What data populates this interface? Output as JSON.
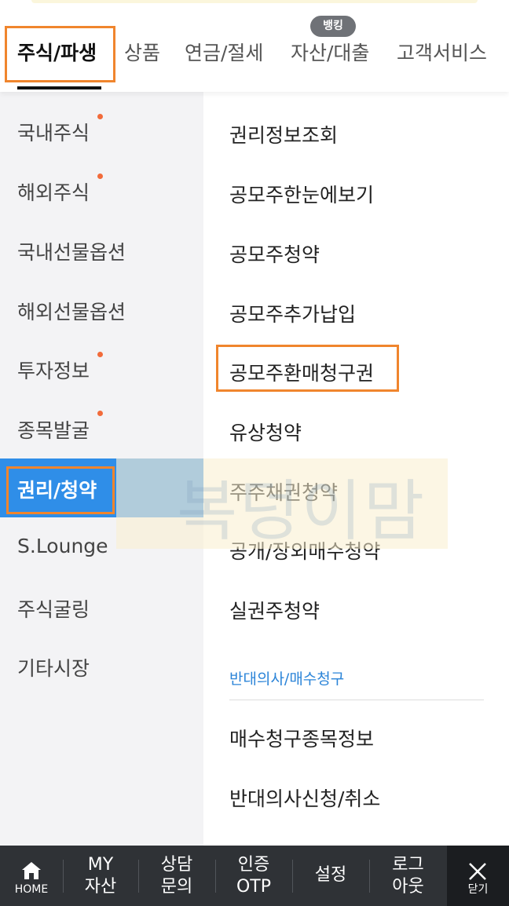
{
  "header": {
    "tabs": [
      {
        "label": "주식/파생",
        "active": true
      },
      {
        "label": "상품"
      },
      {
        "label": "연금/절세"
      },
      {
        "label": "자산/대출",
        "badge": "뱅킹"
      },
      {
        "label": "고객서비스"
      }
    ]
  },
  "left_menu": {
    "items": [
      {
        "label": "국내주식",
        "new": true
      },
      {
        "label": "해외주식",
        "new": true
      },
      {
        "label": "국내선물옵션"
      },
      {
        "label": "해외선물옵션"
      },
      {
        "label": "투자정보",
        "new": true
      },
      {
        "label": "종목발굴",
        "new": true
      },
      {
        "label": "권리/청약",
        "active": true
      },
      {
        "label": "S.Lounge"
      },
      {
        "label": "주식굴링"
      },
      {
        "label": "기타시장"
      }
    ]
  },
  "right_menu": {
    "items": [
      "권리정보조회",
      "공모주한눈에보기",
      "공모주청약",
      "공모주추가납입",
      "공모주환매청구권",
      "유상청약",
      "주주채권청약",
      "공개/장외매수청약",
      "실권주청약"
    ],
    "section": {
      "label": "반대의사/매수청구",
      "items": [
        "매수청구종목정보",
        "반대의사신청/취소"
      ]
    }
  },
  "watermark": "복덩이맘",
  "bottom_bar": {
    "home": "HOME",
    "my": [
      "MY",
      "자산"
    ],
    "consult": [
      "상담",
      "문의"
    ],
    "cert": [
      "인증",
      "OTP"
    ],
    "settings": "설정",
    "logout": [
      "로그",
      "아웃"
    ],
    "close": "닫기"
  },
  "colors": {
    "accent_blue": "#2f8ee8",
    "highlight_orange": "#f0852d",
    "new_dot": "#f26b3a",
    "section_blue": "#2b84d8",
    "bottom_bar": "#2f3236"
  }
}
